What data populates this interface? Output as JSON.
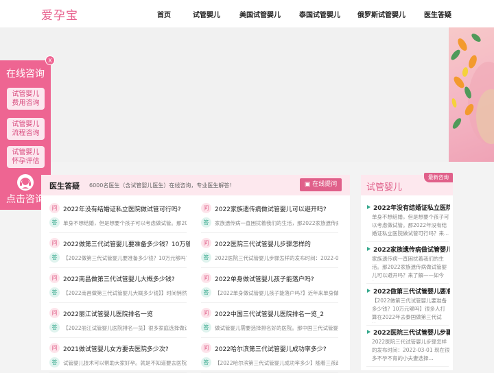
{
  "header": {
    "logo": "爱孕宝",
    "nav": [
      "首页",
      "试管婴儿",
      "美国试管婴儿",
      "泰国试管婴儿",
      "俄罗斯试管婴儿",
      "医生答疑"
    ]
  },
  "float_panel": {
    "close": "X",
    "title": "在线咨询",
    "buttons": [
      {
        "line1": "试管婴儿",
        "line2": "费用咨询"
      },
      {
        "line1": "试管婴儿",
        "line2": "流程咨询"
      },
      {
        "line1": "试管婴儿",
        "line2": "怀孕评估"
      }
    ],
    "bottom": "点击咨询"
  },
  "qa": {
    "title": "医生答疑",
    "subtitle": "6000名医生（含试管婴儿医生）在线咨询，专业医生解答！",
    "ask_button": "在线提问",
    "q_badge": "问",
    "a_badge": "答",
    "items": [
      {
        "q": "2022年没有结婚证私立医院做试管可行吗?",
        "a": "单身不想结婚，但是想要个孩子可以考虑做试管。那2022..."
      },
      {
        "q": "2022家族遗传病做试管婴儿可以避开吗?",
        "a": "家族遗传病一直困扰着我们的生活，那2022家族遗传病做..."
      },
      {
        "q": "2022做第三代试管婴儿要准备多少钱？10万够吗?",
        "a": "【2022做第三代试管婴儿要准备多少钱？10万元够吗？】很..."
      },
      {
        "q": "2022医院三代试管婴儿步骤怎样的",
        "a": "2022医院三代试管婴儿步骤怎样的发布时间：2022-03-01 ..."
      },
      {
        "q": "2022南昌做第三代试管婴儿大概多少钱?",
        "a": "【2022南昌做第三代试管婴儿大概多少钱】】时间悄然流..."
      },
      {
        "q": "2022单身做试管婴儿孩子能落户吗?",
        "a": "【2022单身做试管婴儿孩子能落户吗?】近年来单身做试..."
      },
      {
        "q": "2022丽江试管婴儿医院排名一览",
        "a": "【2022丽江试管婴儿医院排名一览】很多家庭选择做试管..."
      },
      {
        "q": "2022中国三代试管婴儿医院排名一览_2",
        "a": "做试管婴儿需要选择排名好的医院。那中国三代试管婴儿..."
      },
      {
        "q": "2021做试管婴儿女方要去医院多少次?",
        "a": "试管婴儿技术可以帮助大家好孕。就是不知道要去医院多..."
      },
      {
        "q": "2022哈尔滨第三代试管婴儿成功率多少?",
        "a": "【2022哈尔滨第三代试管婴儿成功率多少】随着三孩政..."
      }
    ]
  },
  "side": {
    "title": "试管婴儿",
    "tag": "最新咨询",
    "items": [
      {
        "title": "2022年没有结婚证私立医院...",
        "desc": "单身不想结婚，但是想要个孩子可以考虑做试管。那2022年没有结婚证私立医院做试管可行吗？来..."
      },
      {
        "title": "2022家族遗传病做试管婴儿...",
        "desc": "家族遗传病一直困扰着我们的生活。那2022家族遗传病做试管婴儿可以避开吗？来了解——如今仍..."
      },
      {
        "title": "2022做第三代试管婴儿要准...",
        "desc": "【2022做第三代试管婴儿要准备多少钱？10万元够吗】很多人打算在2022年去泰国做第三代试管..."
      },
      {
        "title": "2022医院三代试管婴儿步骤...",
        "desc": "2022医院三代试管婴儿步骤怎样的发布时间：2022-03-01 现在很多不孕不育的小夫妻选择..."
      }
    ]
  }
}
